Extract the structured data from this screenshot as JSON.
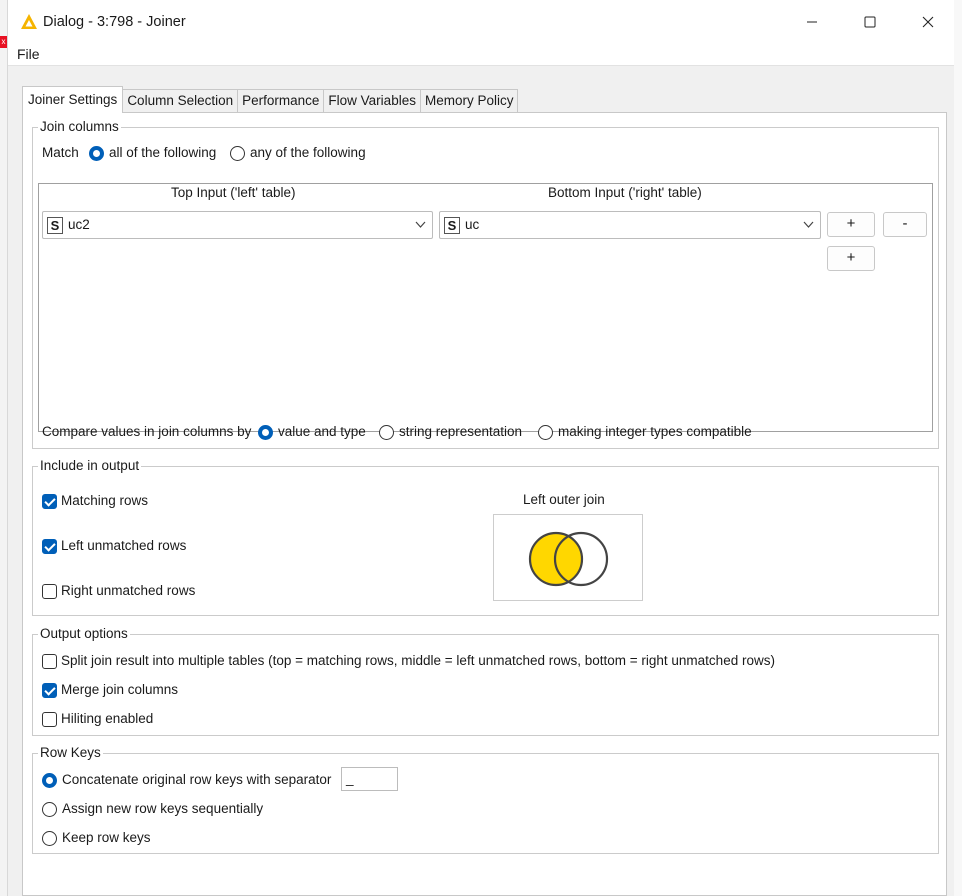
{
  "window": {
    "title": "Dialog - 3:798 - Joiner",
    "menu_file": "File",
    "icons": [
      "knime-triangle-icon",
      "minimize-icon",
      "maximize-icon",
      "close-icon"
    ]
  },
  "tabs": [
    {
      "label": "Joiner Settings",
      "active": true
    },
    {
      "label": "Column Selection",
      "active": false
    },
    {
      "label": "Performance",
      "active": false
    },
    {
      "label": "Flow Variables",
      "active": false
    },
    {
      "label": "Memory Policy",
      "active": false
    }
  ],
  "join_columns": {
    "title": "Join columns",
    "match_label": "Match",
    "match_all": "all of the following",
    "match_any": "any of the following",
    "header_top": "Top Input ('left' table)",
    "header_bottom": "Bottom Input ('right' table)",
    "type_badge": "S",
    "left_value": "uc2",
    "right_value": "uc",
    "add_label": "+",
    "remove_label": "-",
    "compare_label": "Compare values in join columns by",
    "compare_value_type": "value and type",
    "compare_string": "string representation",
    "compare_integer": "making integer types compatible"
  },
  "include": {
    "title": "Include in output",
    "matching": "Matching rows",
    "left_unmatched": "Left unmatched rows",
    "right_unmatched": "Right unmatched rows",
    "matching_checked": true,
    "left_checked": true,
    "right_checked": false,
    "join_type": "Left outer join",
    "venn_fill_color": "#ffd700"
  },
  "output_options": {
    "title": "Output options",
    "split": "Split join result into multiple tables (top = matching rows, middle = left unmatched rows, bottom = right unmatched rows)",
    "merge": "Merge join columns",
    "hiliting": "Hiliting enabled",
    "split_checked": false,
    "merge_checked": true,
    "hiliting_checked": false
  },
  "row_keys": {
    "title": "Row Keys",
    "concat": "Concatenate original row keys with separator",
    "separator": "_",
    "assign": "Assign new row keys sequentially",
    "keep": "Keep row keys"
  },
  "colors": {
    "accent": "#005fb8",
    "venn_yellow": "#ffd700"
  }
}
